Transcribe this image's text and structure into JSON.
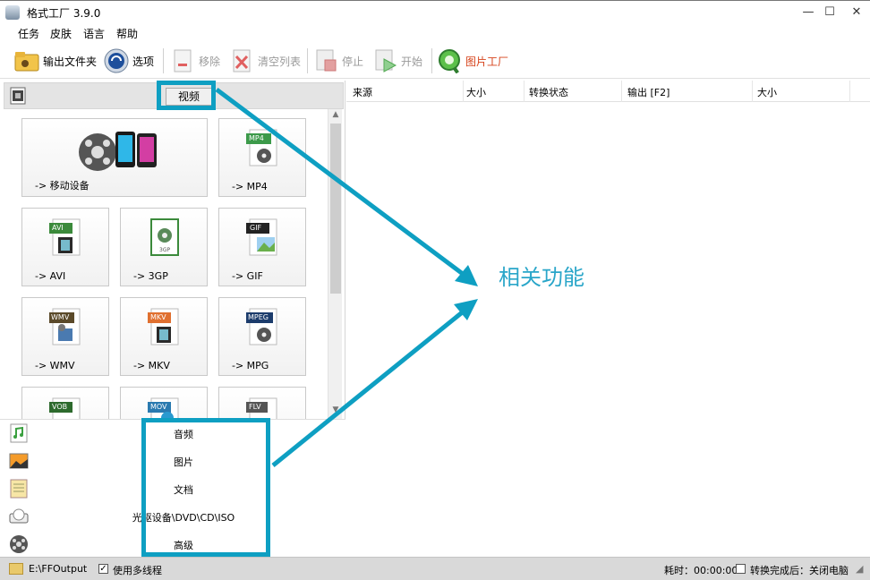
{
  "window": {
    "title": "格式工厂 3.9.0"
  },
  "menu": [
    "任务",
    "皮肤",
    "语言",
    "帮助"
  ],
  "toolbar": {
    "output_folder": "输出文件夹",
    "options": "选项",
    "remove": "移除",
    "clear_list": "清空列表",
    "stop": "停止",
    "start": "开始",
    "picture_factory": "图片工厂"
  },
  "left": {
    "video_btn": "视频",
    "tiles": [
      {
        "label": "-> 移动设备",
        "badge": "",
        "badge_color": ""
      },
      {
        "label": "-> MP4",
        "badge": "MP4",
        "badge_color": "#3c9a4a"
      },
      {
        "label": "-> AVI",
        "badge": "AVI",
        "badge_color": "#3b8a3b"
      },
      {
        "label": "-> 3GP",
        "badge": "3GP",
        "badge_color": "#3b8a3b"
      },
      {
        "label": "-> GIF",
        "badge": "GIF",
        "badge_color": "#222222"
      },
      {
        "label": "-> WMV",
        "badge": "WMV",
        "badge_color": "#5b4a2a"
      },
      {
        "label": "-> MKV",
        "badge": "MKV",
        "badge_color": "#e07030"
      },
      {
        "label": "-> MPG",
        "badge": "MPEG",
        "badge_color": "#1c3c6c"
      },
      {
        "label": "",
        "badge": "VOB",
        "badge_color": "#2d6a2d"
      },
      {
        "label": "",
        "badge": "MOV",
        "badge_color": "#2a7ab0"
      },
      {
        "label": "",
        "badge": "FLV",
        "badge_color": "#555555"
      }
    ],
    "categories": [
      "音频",
      "图片",
      "文档",
      "光驱设备\\DVD\\CD\\ISO",
      "高级"
    ]
  },
  "columns": [
    "来源",
    "大小",
    "转换状态",
    "输出 [F2]",
    "大小"
  ],
  "annotation": "相关功能",
  "status": {
    "output_path": "E:\\FFOutput",
    "multithread_label": "使用多线程",
    "multithread_checked": true,
    "elapsed": "耗时：00:00:00",
    "shutdown_label": "转换完成后：关闭电脑",
    "shutdown_checked": false
  },
  "colors": {
    "accent": "#0e9fc2",
    "annotation_text": "#2aa6c9"
  }
}
